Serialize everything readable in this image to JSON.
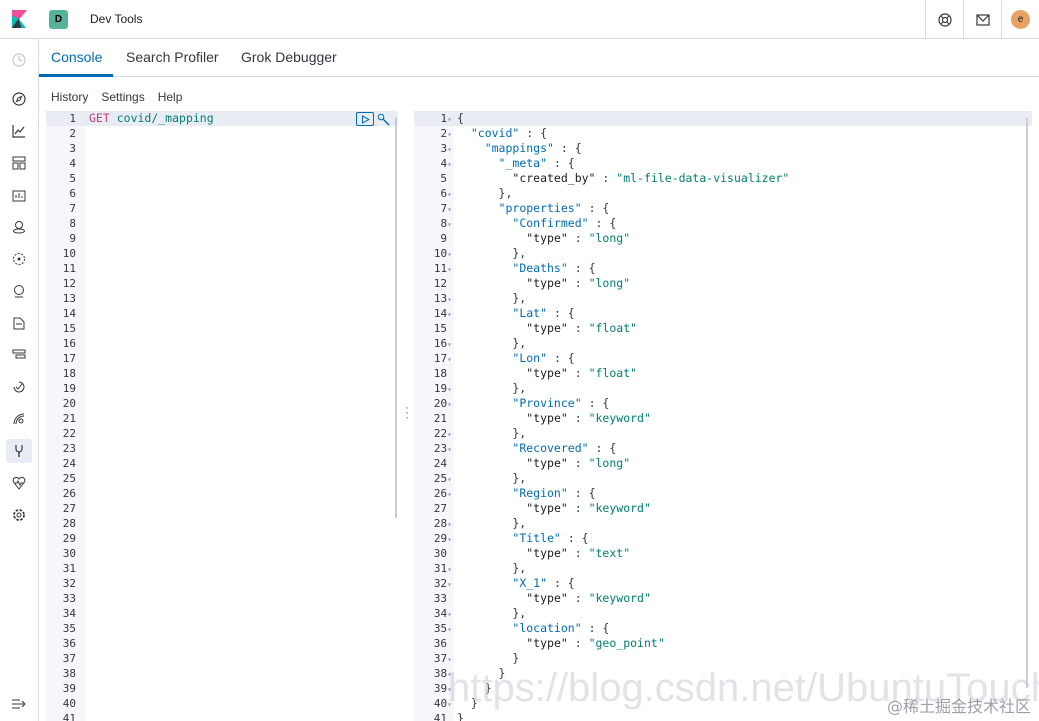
{
  "header": {
    "space_initial": "D",
    "app_title": "Dev Tools",
    "user_initial": "e"
  },
  "tabs": [
    {
      "label": "Console",
      "active": true
    },
    {
      "label": "Search Profiler",
      "active": false
    },
    {
      "label": "Grok Debugger",
      "active": false
    }
  ],
  "console_menu": {
    "history": "History",
    "settings": "Settings",
    "help": "Help"
  },
  "request": {
    "method": "GET",
    "path": "covid/_mapping",
    "line_count": 41
  },
  "response_lines": [
    "{",
    "  \"covid\" : {",
    "    \"mappings\" : {",
    "      \"_meta\" : {",
    "        \"created_by\" : \"ml-file-data-visualizer\"",
    "      },",
    "      \"properties\" : {",
    "        \"Confirmed\" : {",
    "          \"type\" : \"long\"",
    "        },",
    "        \"Deaths\" : {",
    "          \"type\" : \"long\"",
    "        },",
    "        \"Lat\" : {",
    "          \"type\" : \"float\"",
    "        },",
    "        \"Lon\" : {",
    "          \"type\" : \"float\"",
    "        },",
    "        \"Province\" : {",
    "          \"type\" : \"keyword\"",
    "        },",
    "        \"Recovered\" : {",
    "          \"type\" : \"long\"",
    "        },",
    "        \"Region\" : {",
    "          \"type\" : \"keyword\"",
    "        },",
    "        \"Title\" : {",
    "          \"type\" : \"text\"",
    "        },",
    "        \"X_1\" : {",
    "          \"type\" : \"keyword\"",
    "        },",
    "        \"location\" : {",
    "          \"type\" : \"geo_point\"",
    "        }",
    "      }",
    "    }",
    "  }",
    "}"
  ],
  "fold_lines": [
    1,
    2,
    3,
    4,
    6,
    7,
    8,
    10,
    11,
    13,
    14,
    16,
    17,
    19,
    20,
    22,
    23,
    25,
    26,
    28,
    29,
    31,
    32,
    34,
    35,
    37,
    38,
    39,
    40
  ],
  "watermark": "@稀土掘金技术社区",
  "watermark_url": "https://blog.csdn.net/UbuntuTouch",
  "colors": {
    "accent": "#006bb4",
    "string": "#017d73",
    "method": "#c4407c"
  }
}
